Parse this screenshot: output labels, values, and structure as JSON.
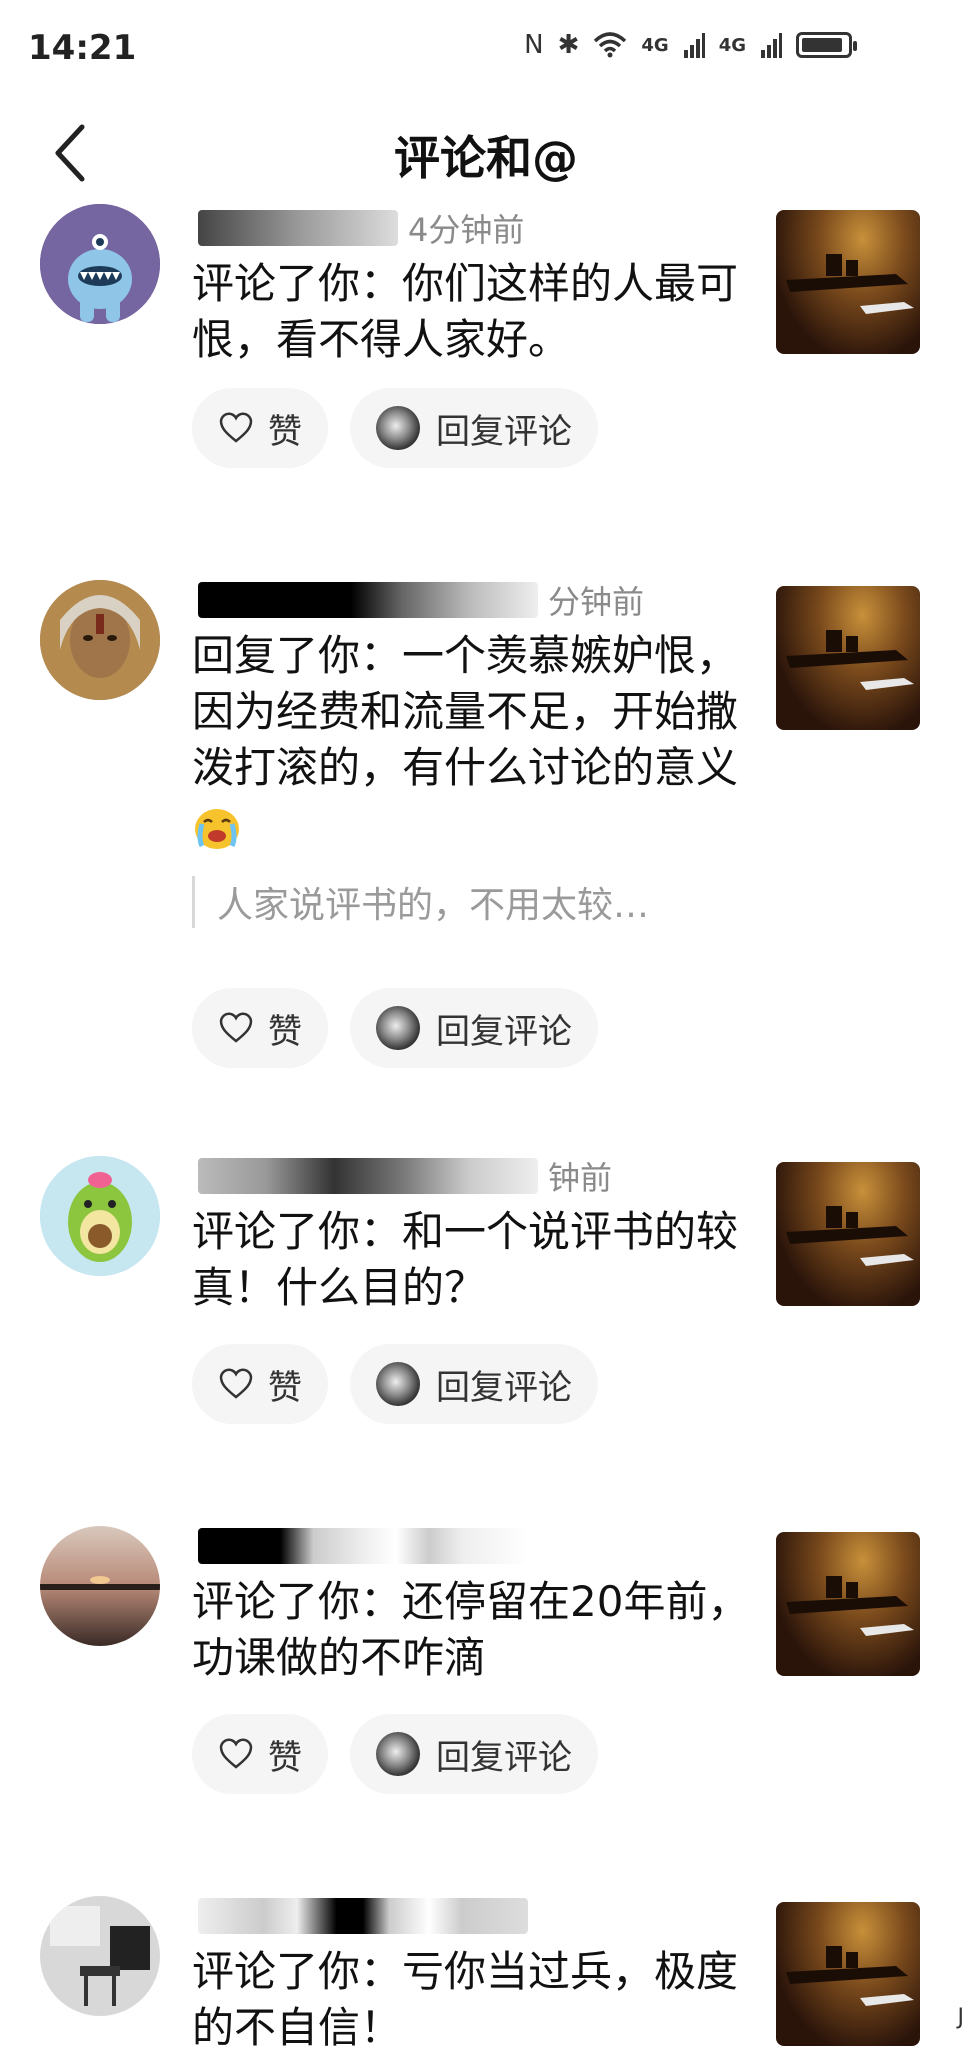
{
  "status_bar": {
    "time": "14:21",
    "nfc": "N",
    "bluetooth": "✱",
    "wifi": "wifi",
    "net1": "4G",
    "net2": "4G"
  },
  "header": {
    "title": "评论和@"
  },
  "items": [
    {
      "time_ago": "4分钟前",
      "comment": "评论了你：你们这样的人最可恨，看不得人家好。",
      "like_label": "赞",
      "reply_label": "回复评论"
    },
    {
      "time_ago": "分钟前",
      "comment": "回复了你：一个羡慕嫉妒恨，因为经费和流量不足，开始撒泼打滚的，有什么讨论的意义",
      "quote": "人家说评书的，不用太较…",
      "like_label": "赞",
      "reply_label": "回复评论"
    },
    {
      "time_ago": "钟前",
      "comment": "评论了你：和一个说评书的较真！什么目的？",
      "like_label": "赞",
      "reply_label": "回复评论"
    },
    {
      "comment": "评论了你：还停留在20年前，功课做的不咋滴",
      "like_label": "赞",
      "reply_label": "回复评论"
    },
    {
      "comment": "评论了你：亏你当过兵，极度的不自信！"
    }
  ],
  "icons": {
    "back": "chevron-left-icon",
    "like": "heart-icon"
  },
  "colors": {
    "background": "#ffffff",
    "pill": "#f5f5f5",
    "muted": "#8a8a8a"
  },
  "edge_char": "J"
}
